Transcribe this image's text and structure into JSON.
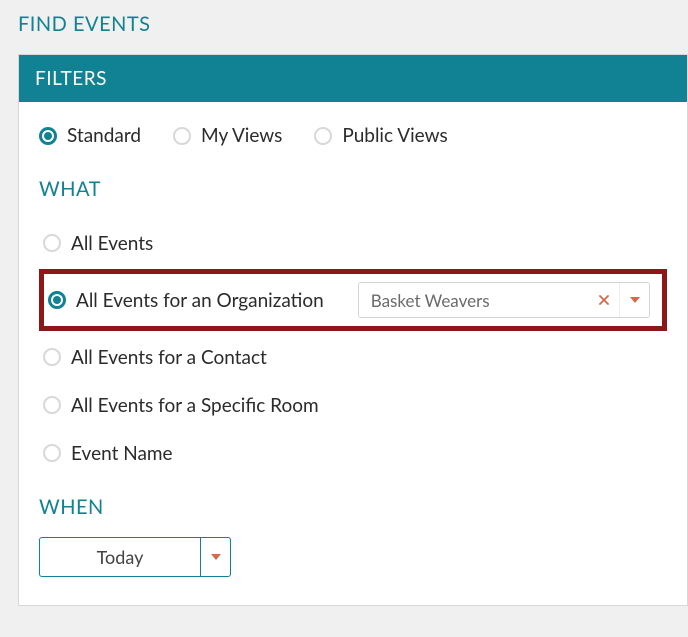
{
  "page": {
    "title": "FIND EVENTS"
  },
  "panel": {
    "header": "FILTERS"
  },
  "views": {
    "items": [
      {
        "label": "Standard",
        "selected": true
      },
      {
        "label": "My Views",
        "selected": false
      },
      {
        "label": "Public Views",
        "selected": false
      }
    ]
  },
  "what": {
    "section_label": "WHAT",
    "options": [
      {
        "label": "All Events",
        "selected": false
      },
      {
        "label": "All Events for an Organization",
        "selected": true,
        "highlighted": true,
        "org_value": "Basket Weavers"
      },
      {
        "label": "All Events for a Contact",
        "selected": false
      },
      {
        "label": "All Events for a Specific Room",
        "selected": false
      },
      {
        "label": "Event Name",
        "selected": false
      }
    ]
  },
  "when": {
    "section_label": "WHEN",
    "value": "Today"
  }
}
